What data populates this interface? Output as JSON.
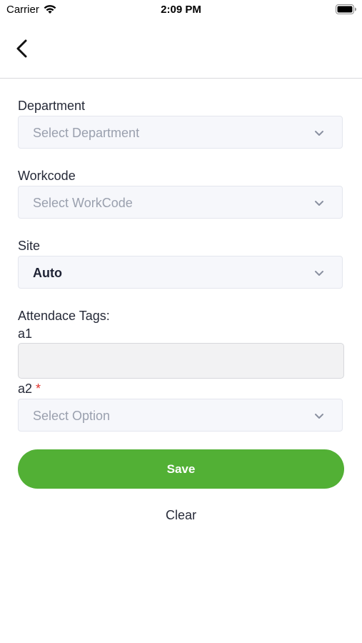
{
  "status_bar": {
    "carrier": "Carrier",
    "time": "2:09 PM",
    "wifi_icon": "wifi-icon",
    "battery_icon": "battery-icon"
  },
  "nav": {
    "back_icon": "chevron-left-icon"
  },
  "form": {
    "department": {
      "label": "Department",
      "placeholder": "Select Department"
    },
    "workcode": {
      "label": "Workcode",
      "placeholder": "Select WorkCode"
    },
    "site": {
      "label": "Site",
      "value": "Auto"
    },
    "attendance_tags": {
      "heading": "Attendace Tags:",
      "a1": {
        "label": "a1",
        "value": ""
      },
      "a2": {
        "label": "a2",
        "required_marker": "*",
        "placeholder": "Select Option"
      }
    },
    "save_label": "Save",
    "clear_label": "Clear"
  },
  "colors": {
    "accent_green": "#52b035",
    "required_red": "#e2342d",
    "placeholder_gray": "#9aa0ae"
  }
}
